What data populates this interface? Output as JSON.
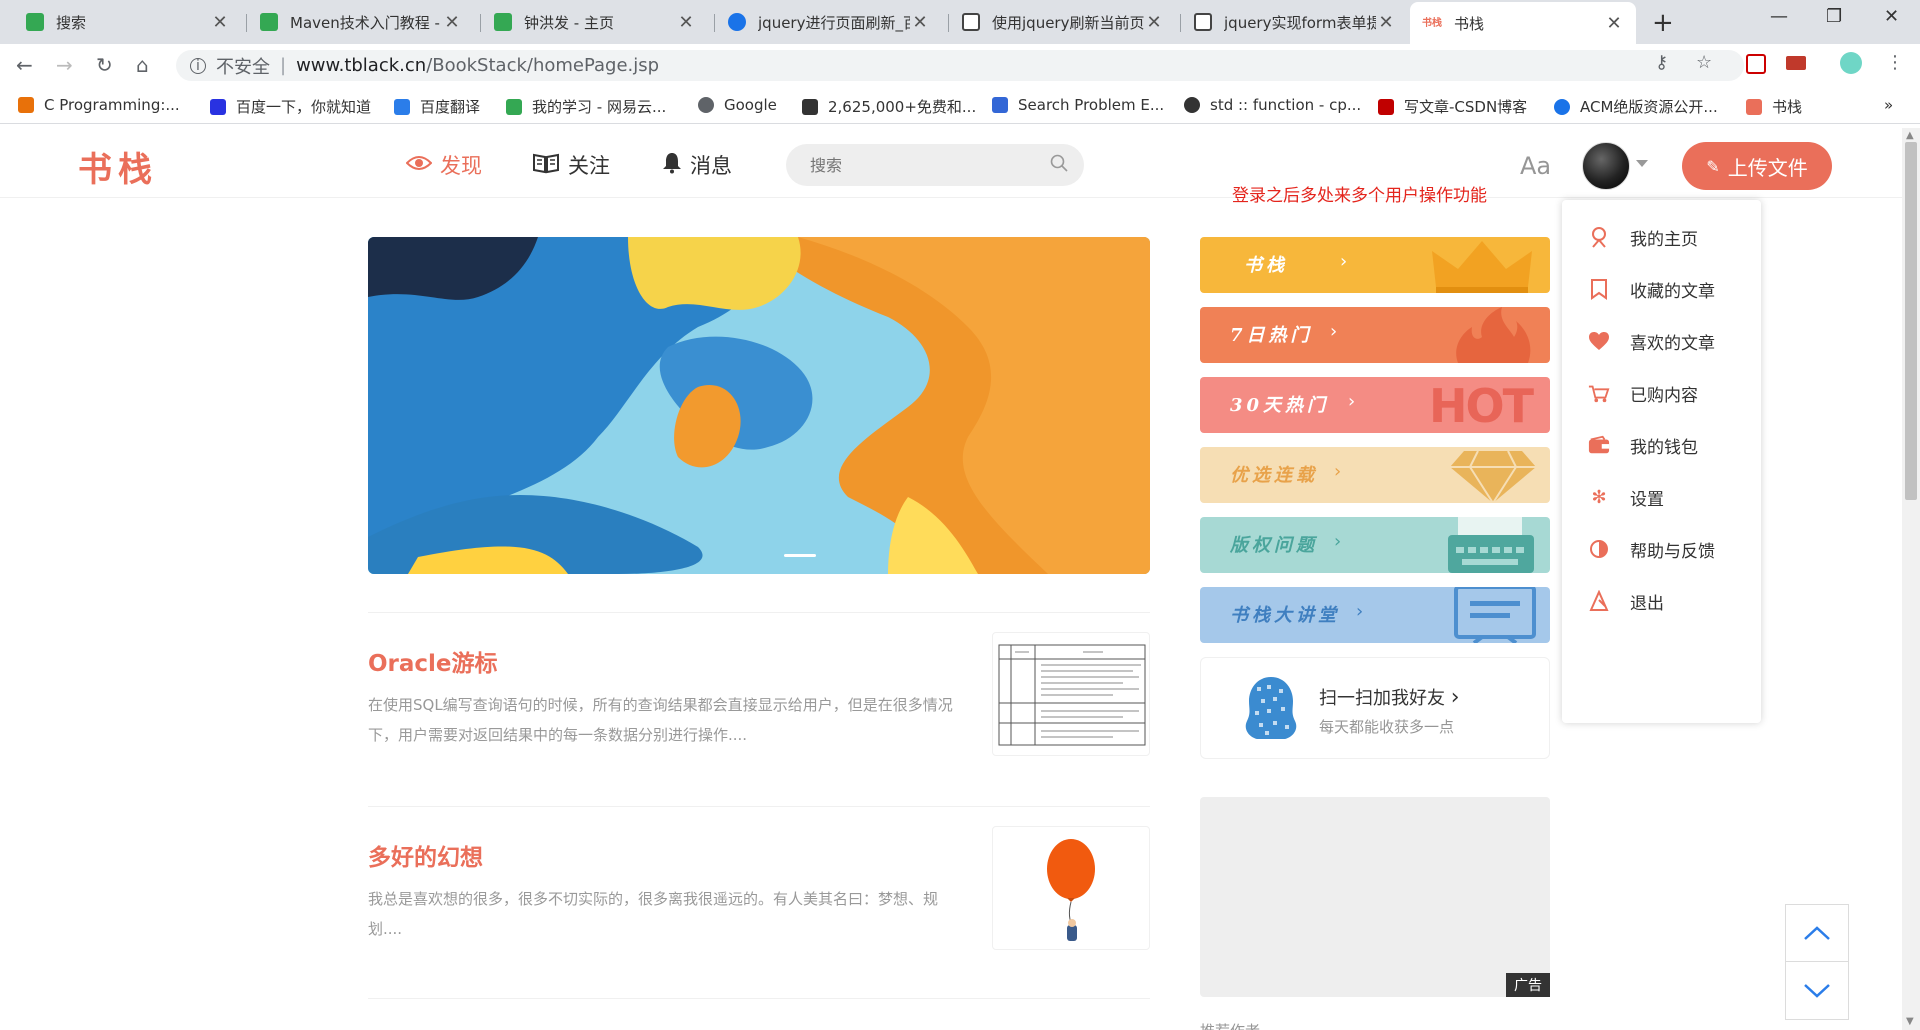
{
  "browser": {
    "tabs": [
      {
        "title": "搜索",
        "favicon_color": "#34a853",
        "active": false
      },
      {
        "title": "Maven技术入门教程 - ",
        "favicon_color": "#34a853",
        "active": false
      },
      {
        "title": "钟洪发 - 主页",
        "favicon_color": "#34a853",
        "active": false
      },
      {
        "title": "jquery进行页面刷新_百",
        "favicon_color": "#1a73e8",
        "active": false
      },
      {
        "title": "使用jquery刷新当前页",
        "favicon_color": "#444444",
        "active": false
      },
      {
        "title": "jquery实现form表单提",
        "favicon_color": "#444444",
        "active": false
      },
      {
        "title": "书栈",
        "favicon_text": "书栈",
        "favicon_color": "#ea6f5a",
        "active": true
      }
    ],
    "address": {
      "security_label": "不安全",
      "host": "www.tblack.cn",
      "path": "/BookStack/homePage.jsp"
    },
    "bookmarks": [
      {
        "label": "C Programming:...",
        "icon_color": "#e8710a"
      },
      {
        "label": "百度一下，你就知道",
        "icon_color": "#2932e1"
      },
      {
        "label": "百度翻译",
        "icon_color": "#2b7de9"
      },
      {
        "label": "我的学习 - 网易云...",
        "icon_color": "#34a853"
      },
      {
        "label": "Google",
        "icon_color": "#5f6368"
      },
      {
        "label": "2,625,000+免费和...",
        "icon_color": "#333333"
      },
      {
        "label": "Search Problem E...",
        "icon_color": "#3367d6"
      },
      {
        "label": "std :: function - cp...",
        "icon_color": "#333333"
      },
      {
        "label": "写文章-CSDN博客",
        "icon_color": "#c00000"
      },
      {
        "label": "ACM绝版资源公开...",
        "icon_color": "#1a73e8"
      },
      {
        "label": "书栈",
        "icon_color": "#ea6f5a"
      }
    ],
    "bookmarks_overflow": "»"
  },
  "site": {
    "logo": "书栈",
    "nav": [
      {
        "label": "发现",
        "icon": "eye-icon",
        "active": true
      },
      {
        "label": "关注",
        "icon": "book-icon",
        "active": false
      },
      {
        "label": "消息",
        "icon": "bell-icon",
        "active": false
      }
    ],
    "search_placeholder": "搜索",
    "font_toggle": "Aa",
    "upload_label": "上传文件",
    "accent_color": "#ea6f5a"
  },
  "annotation": "登录之后多处来多个用户操作功能",
  "articles": [
    {
      "title": "Oracle游标",
      "abstract": "在使用SQL编写查询语句的时候，所有的查询结果都会直接显示给用户，但是在很多情况下，用户需要对返回结果中的每一条数据分别进行操作...."
    },
    {
      "title": "多好的幻想",
      "abstract": "我总是喜欢想的很多，很多不切实际的，很多离我很遥远的。有人美其名曰：梦想、规划...."
    }
  ],
  "sidebar": {
    "cards": [
      {
        "label": "书栈",
        "bg": "#f7b73b",
        "decor": "crown-icon"
      },
      {
        "label": "7日热门",
        "bg": "#f08156",
        "decor": "flame-icon"
      },
      {
        "label": "30天热门",
        "bg": "#f48c84",
        "decor": "hot-icon",
        "decor_text": "HOT"
      },
      {
        "label": "优选连载",
        "bg": "#f6deb4",
        "decor": "diamond-icon"
      },
      {
        "label": "版权问题",
        "bg": "#a7d9d4",
        "decor": "typewriter-icon"
      },
      {
        "label": "书栈大讲堂",
        "bg": "#a5c8ea",
        "decor": "screen-icon"
      }
    ],
    "qr": {
      "title": "扫一扫加我好友",
      "subtitle": "每天都能收获多一点"
    },
    "ad_tag": "广告",
    "recommend_label": "推荐作者"
  },
  "dropdown": [
    {
      "label": "我的主页",
      "icon": "user-icon"
    },
    {
      "label": "收藏的文章",
      "icon": "bookmark-icon"
    },
    {
      "label": "喜欢的文章",
      "icon": "heart-icon"
    },
    {
      "label": "已购内容",
      "icon": "cart-icon"
    },
    {
      "label": "我的钱包",
      "icon": "wallet-icon"
    },
    {
      "label": "设置",
      "icon": "settings-icon"
    },
    {
      "label": "帮助与反馈",
      "icon": "help-icon"
    },
    {
      "label": "退出",
      "icon": "logout-icon"
    }
  ]
}
